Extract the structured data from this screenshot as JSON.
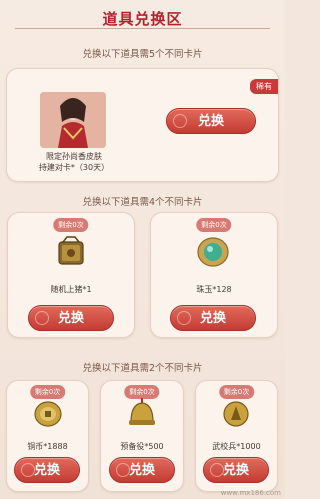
{
  "header": {
    "title": "道具兑换区"
  },
  "sections": [
    {
      "subtitle": "兑换以下道具需5个不同卡片"
    },
    {
      "subtitle": "兑换以下道具需4个不同卡片"
    },
    {
      "subtitle": "兑换以下道具需2个不同卡片"
    }
  ],
  "premium": {
    "badge": "稀有",
    "line1": "限定孙尚香皮肤",
    "line2": "持建对卡*（30天）",
    "button": "兑换"
  },
  "tier4": [
    {
      "remain": "剩余0次",
      "label": "随机上猪*1",
      "button": "兑换",
      "icon": "bronze-chest-icon"
    },
    {
      "remain": "剩余0次",
      "label": "珠玉*128",
      "button": "兑换",
      "icon": "jade-orb-icon"
    }
  ],
  "tier2": [
    {
      "remain": "剩余0次",
      "label": "铜币*1888",
      "button": "兑换",
      "icon": "coin-icon"
    },
    {
      "remain": "剩余0次",
      "label": "预备役*500",
      "button": "兑换",
      "icon": "helmet-icon"
    },
    {
      "remain": "剩余0次",
      "label": "武校兵*1000",
      "button": "兑换",
      "icon": "soldier-medal-icon"
    }
  ],
  "watermark": "www.mx186.com"
}
